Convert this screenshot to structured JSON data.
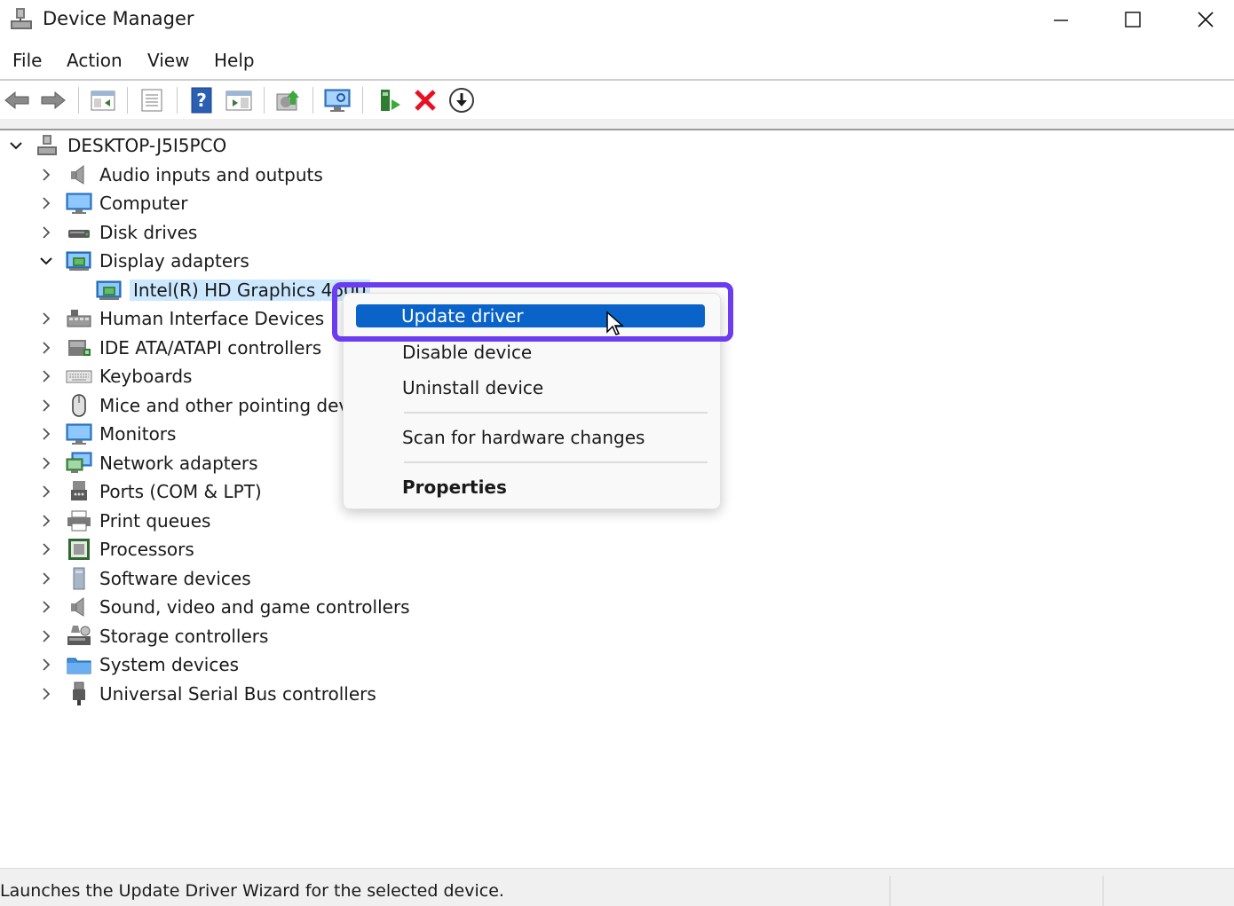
{
  "window": {
    "title": "Device Manager",
    "icon": "device-manager-icon",
    "controls": [
      "minimize-icon",
      "maximize-icon",
      "close-icon"
    ]
  },
  "menubar": {
    "items": [
      {
        "label": "File"
      },
      {
        "label": "Action"
      },
      {
        "label": "View"
      },
      {
        "label": "Help"
      }
    ]
  },
  "toolbar": {
    "buttons": [
      "back-arrow-icon",
      "forward-arrow-icon",
      "console-tree-icon",
      "properties-icon",
      "help-icon",
      "action-pane-icon",
      "update-driver-icon",
      "scan-hardware-icon",
      "add-legacy-icon",
      "uninstall-icon",
      "enable-device-icon"
    ],
    "colors": {
      "uninstall": "#e81123",
      "help": "#2b5fb3"
    }
  },
  "tree": {
    "root": {
      "label": "DESKTOP-J5I5PCO",
      "expanded": true
    },
    "categories": [
      {
        "label": "Audio inputs and outputs",
        "icon": "speaker-icon",
        "expanded": false
      },
      {
        "label": "Computer",
        "icon": "monitor-icon",
        "expanded": false
      },
      {
        "label": "Disk drives",
        "icon": "disk-drive-icon",
        "expanded": false
      },
      {
        "label": "Display adapters",
        "icon": "display-adapter-icon",
        "expanded": true,
        "children": [
          {
            "label": "Intel(R) HD Graphics 4600",
            "icon": "display-adapter-icon",
            "selected": true
          }
        ]
      },
      {
        "label": "Human Interface Devices",
        "icon": "hid-icon",
        "expanded": false
      },
      {
        "label": "IDE ATA/ATAPI controllers",
        "icon": "ide-controller-icon",
        "expanded": false
      },
      {
        "label": "Keyboards",
        "icon": "keyboard-icon",
        "expanded": false
      },
      {
        "label": "Mice and other pointing devices",
        "icon": "mouse-icon",
        "expanded": false
      },
      {
        "label": "Monitors",
        "icon": "monitor-icon",
        "expanded": false
      },
      {
        "label": "Network adapters",
        "icon": "network-icon",
        "expanded": false
      },
      {
        "label": "Ports (COM & LPT)",
        "icon": "port-icon",
        "expanded": false
      },
      {
        "label": "Print queues",
        "icon": "printer-icon",
        "expanded": false
      },
      {
        "label": "Processors",
        "icon": "processor-icon",
        "expanded": false
      },
      {
        "label": "Software devices",
        "icon": "software-device-icon",
        "expanded": false
      },
      {
        "label": "Sound, video and game controllers",
        "icon": "speaker-icon",
        "expanded": false
      },
      {
        "label": "Storage controllers",
        "icon": "storage-icon",
        "expanded": false
      },
      {
        "label": "System devices",
        "icon": "system-folder-icon",
        "expanded": false
      },
      {
        "label": "Universal Serial Bus controllers",
        "icon": "usb-icon",
        "expanded": false
      }
    ]
  },
  "context_menu": {
    "items": [
      {
        "label": "Update driver",
        "highlighted": true
      },
      {
        "label": "Disable device"
      },
      {
        "label": "Uninstall device"
      },
      {
        "label": "Scan for hardware changes"
      },
      {
        "label": "Properties",
        "bold": true
      }
    ],
    "highlight_color": "#0a63c9",
    "focus_frame_color": "#6b3cf0"
  },
  "statusbar": {
    "text": "Launches the Update Driver Wizard for the selected device."
  }
}
